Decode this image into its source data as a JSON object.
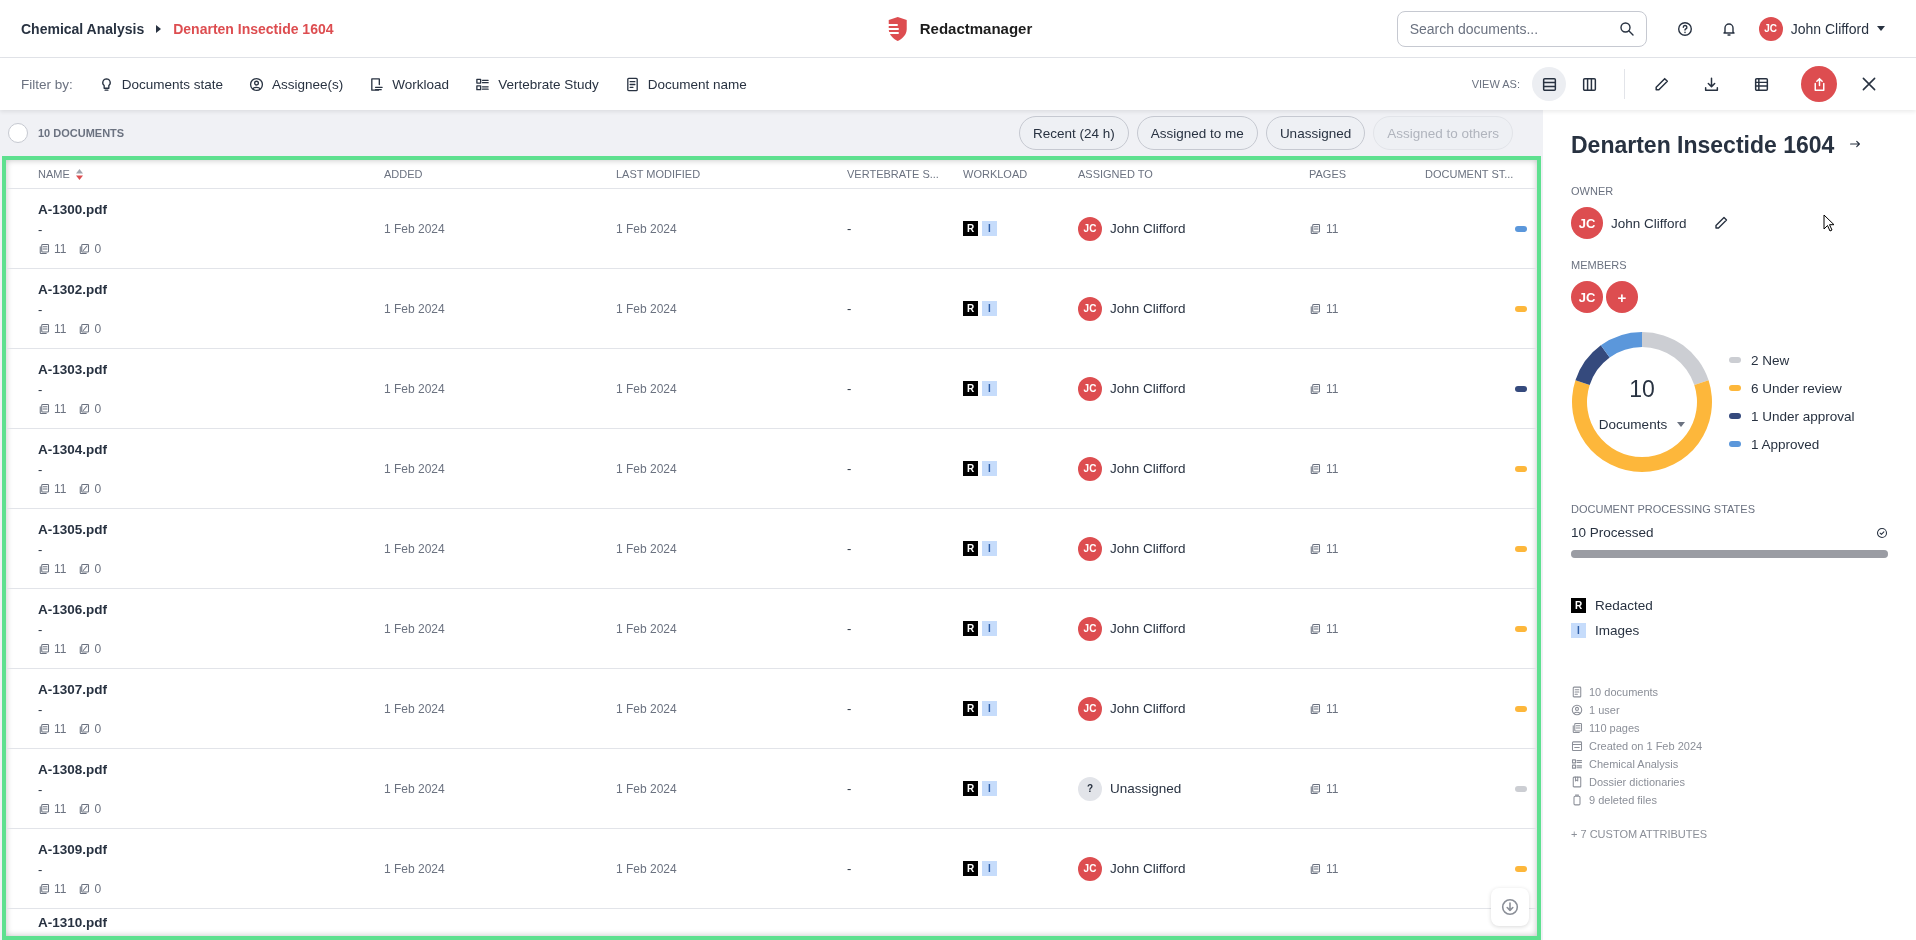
{
  "header": {
    "breadcrumb": [
      {
        "label": "Chemical Analysis",
        "selected": false
      },
      {
        "label": "Denarten Insectide 1604",
        "selected": true
      }
    ],
    "logo_text": "Redactmanager",
    "search": {
      "placeholder": "Search documents..."
    },
    "user": {
      "initials": "JC",
      "name": "John Clifford"
    }
  },
  "filter_bar": {
    "label": "Filter by:",
    "filters": [
      {
        "kind": "state",
        "label": "Documents state"
      },
      {
        "kind": "assignee",
        "label": "Assignee(s)"
      },
      {
        "kind": "workload",
        "label": "Workload"
      },
      {
        "kind": "study",
        "label": "Vertebrate Study"
      },
      {
        "kind": "name",
        "label": "Document name"
      }
    ],
    "view_as": {
      "label": "VIEW AS:",
      "options": [
        {
          "kind": "list",
          "selected": true
        },
        {
          "kind": "columns",
          "selected": false
        }
      ]
    }
  },
  "list_toolbar": {
    "select_all": {
      "checked": false
    },
    "count": "10 DOCUMENTS",
    "chips": [
      {
        "label": "Recent (24 h)",
        "disabled": false
      },
      {
        "label": "Assigned to me",
        "disabled": false
      },
      {
        "label": "Unassigned",
        "disabled": false
      },
      {
        "label": "Assigned to others",
        "disabled": true
      }
    ]
  },
  "table": {
    "columns": [
      "NAME",
      "ADDED",
      "LAST MODIFIED",
      "VERTEBRATE S...",
      "WORKLOAD",
      "ASSIGNED TO",
      "PAGES",
      "DOCUMENT ST..."
    ],
    "rows": [
      {
        "name": "A-1300.pdf",
        "subtitle": "-",
        "pages_meta": "11",
        "images_meta": "0",
        "added": "1 Feb 2024",
        "modified": "1 Feb 2024",
        "vertebrate": "-",
        "workload": [
          "R",
          "I"
        ],
        "assigned": true,
        "initials": "JC",
        "assignee": "John Clifford",
        "pages": "11",
        "color": "#5b97db"
      },
      {
        "name": "A-1302.pdf",
        "subtitle": "-",
        "pages_meta": "11",
        "images_meta": "0",
        "added": "1 Feb 2024",
        "modified": "1 Feb 2024",
        "vertebrate": "-",
        "workload": [
          "R",
          "I"
        ],
        "assigned": true,
        "initials": "JC",
        "assignee": "John Clifford",
        "pages": "11",
        "color": "#fdb73b"
      },
      {
        "name": "A-1303.pdf",
        "subtitle": "-",
        "pages_meta": "11",
        "images_meta": "0",
        "added": "1 Feb 2024",
        "modified": "1 Feb 2024",
        "vertebrate": "-",
        "workload": [
          "R",
          "I"
        ],
        "assigned": true,
        "initials": "JC",
        "assignee": "John Clifford",
        "pages": "11",
        "color": "#354a7d"
      },
      {
        "name": "A-1304.pdf",
        "subtitle": "-",
        "pages_meta": "11",
        "images_meta": "0",
        "added": "1 Feb 2024",
        "modified": "1 Feb 2024",
        "vertebrate": "-",
        "workload": [
          "R",
          "I"
        ],
        "assigned": true,
        "initials": "JC",
        "assignee": "John Clifford",
        "pages": "11",
        "color": "#fdb73b"
      },
      {
        "name": "A-1305.pdf",
        "subtitle": "-",
        "pages_meta": "11",
        "images_meta": "0",
        "added": "1 Feb 2024",
        "modified": "1 Feb 2024",
        "vertebrate": "-",
        "workload": [
          "R",
          "I"
        ],
        "assigned": true,
        "initials": "JC",
        "assignee": "John Clifford",
        "pages": "11",
        "color": "#fdb73b"
      },
      {
        "name": "A-1306.pdf",
        "subtitle": "-",
        "pages_meta": "11",
        "images_meta": "0",
        "added": "1 Feb 2024",
        "modified": "1 Feb 2024",
        "vertebrate": "-",
        "workload": [
          "R",
          "I"
        ],
        "assigned": true,
        "initials": "JC",
        "assignee": "John Clifford",
        "pages": "11",
        "color": "#fdb73b"
      },
      {
        "name": "A-1307.pdf",
        "subtitle": "-",
        "pages_meta": "11",
        "images_meta": "0",
        "added": "1 Feb 2024",
        "modified": "1 Feb 2024",
        "vertebrate": "-",
        "workload": [
          "R",
          "I"
        ],
        "assigned": true,
        "initials": "JC",
        "assignee": "John Clifford",
        "pages": "11",
        "color": "#fdb73b"
      },
      {
        "name": "A-1308.pdf",
        "subtitle": "-",
        "pages_meta": "11",
        "images_meta": "0",
        "added": "1 Feb 2024",
        "modified": "1 Feb 2024",
        "vertebrate": "-",
        "workload": [
          "R",
          "I"
        ],
        "assigned": false,
        "initials": "?",
        "assignee": "Unassigned",
        "pages": "11",
        "color": "#ccced3"
      },
      {
        "name": "A-1309.pdf",
        "subtitle": "-",
        "pages_meta": "11",
        "images_meta": "0",
        "added": "1 Feb 2024",
        "modified": "1 Feb 2024",
        "vertebrate": "-",
        "workload": [
          "R",
          "I"
        ],
        "assigned": true,
        "initials": "JC",
        "assignee": "John Clifford",
        "pages": "11",
        "color": "#fdb73b"
      },
      {
        "name": "A-1310.pdf"
      }
    ]
  },
  "details": {
    "title": "Denarten Insectide 1604",
    "owner_label": "OWNER",
    "owner": {
      "initials": "JC",
      "name": "John Clifford"
    },
    "members_label": "MEMBERS",
    "members": [
      {
        "kind": "user",
        "initials": "JC"
      },
      {
        "kind": "add",
        "initials": "+"
      }
    ],
    "donut": {
      "total": "10",
      "caption": "Documents",
      "chart_data": {
        "type": "donut",
        "categories": [
          "New",
          "Under review",
          "Under approval",
          "Approved"
        ],
        "values": [
          20,
          60,
          10,
          10
        ]
      }
    },
    "legend": [
      {
        "count": "2",
        "color": "#ccced3"
      },
      {
        "count": "6",
        "color": "#fdb73b"
      },
      {
        "count": "1",
        "color": "#354a7d"
      },
      {
        "count": "1",
        "color": "#5b97db"
      }
    ],
    "processing_label": "DOCUMENT PROCESSING STATES",
    "processing": {
      "label": "10 Processed",
      "level": 1
    },
    "workload_legend": [
      {
        "badge": "R",
        "kind": "redacted",
        "label": "Redacted"
      },
      {
        "badge": "I",
        "kind": "images",
        "label": "Images"
      }
    ],
    "stats": [
      {
        "kind": "documents",
        "label": "10 documents"
      },
      {
        "kind": "users",
        "label": "1 user"
      },
      {
        "kind": "pages",
        "label": "110 pages"
      },
      {
        "kind": "created",
        "label": "Created on 1 Feb 2024"
      },
      {
        "kind": "template",
        "label": "Chemical Analysis"
      },
      {
        "kind": "dictionary",
        "label": "Dossier dictionaries"
      },
      {
        "kind": "deleted",
        "label": "9 deleted files"
      }
    ],
    "custom_attributes": "+ 7 CUSTOM ATTRIBUTES"
  }
}
